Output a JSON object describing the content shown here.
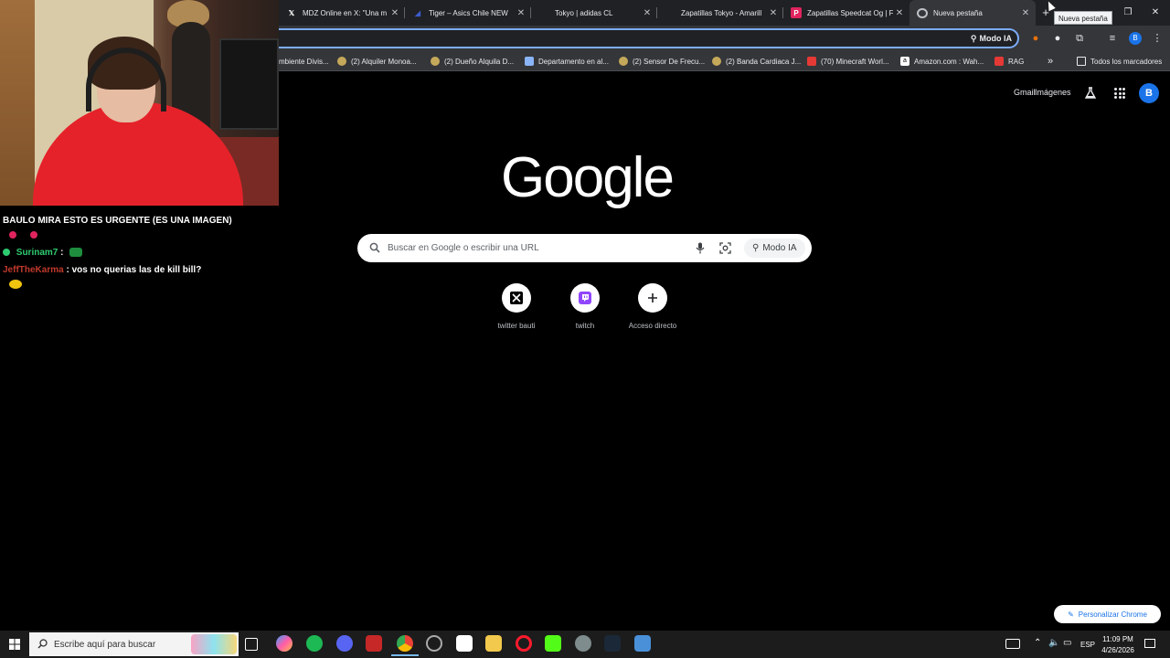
{
  "browser": {
    "tabs": [
      {
        "title": "MDZ Online en X: \"Una m",
        "icon": "x-logo-icon",
        "active": false
      },
      {
        "title": "Tiger – Asics Chile NEW",
        "icon": "asics-logo-icon",
        "active": false
      },
      {
        "title": "Tokyo | adidas CL",
        "icon": "adidas-logo-icon",
        "active": false
      },
      {
        "title": "Zapatillas Tokyo - Amarill",
        "icon": "adidas-logo-icon",
        "active": false
      },
      {
        "title": "Zapatillas Speedcat Og | F",
        "icon": "puma-logo-icon",
        "active": false
      },
      {
        "title": "Nueva pestaña",
        "icon": "chrome-icon",
        "active": true
      }
    ],
    "new_tab_tooltip": "Nueva pestaña",
    "omnibox": {
      "value": "",
      "modo_ia_label": "Modo IA"
    },
    "profile_initial": "B",
    "bookmarks": [
      {
        "label": "mbiente Divis..."
      },
      {
        "label": "(2) Alquiler Monoa..."
      },
      {
        "label": "(2) Dueño Alquila D..."
      },
      {
        "label": "Departamento en al..."
      },
      {
        "label": "(2) Sensor De Frecu..."
      },
      {
        "label": "(2) Banda Cardiaca J..."
      },
      {
        "label": "(70) Minecraft Worl..."
      },
      {
        "label": "Amazon.com : Wah..."
      },
      {
        "label": "RAG"
      }
    ],
    "bookmarks_overflow": "»",
    "all_bookmarks_label": "Todos los marcadores"
  },
  "ntp": {
    "gmail_label": "Gmail",
    "images_label": "Imágenes",
    "account_initial": "B",
    "logo_text": "Google",
    "search": {
      "placeholder": "Buscar en Google o escribir una URL",
      "modo_ia_label": "Modo IA"
    },
    "shortcuts": [
      {
        "label": "twitter bauti",
        "icon": "x-logo-icon"
      },
      {
        "label": "twitch",
        "icon": "twitch-icon"
      },
      {
        "label": "Acceso directo",
        "icon": "plus-icon"
      }
    ],
    "personalize_label": "Personalizar Chrome"
  },
  "chat": {
    "messages": [
      {
        "user": "",
        "text": "BAULO MIRA ESTO ES URGENTE (ES UNA IMAGEN)",
        "user_color": "#ffffff"
      },
      {
        "user": "Surinam7",
        "text": ":",
        "user_color": "#2ecc71"
      },
      {
        "user": "JeffTheKarma",
        "text": ": vos no querias las de kill bill?",
        "user_color": "#c0392b"
      }
    ]
  },
  "taskbar": {
    "search_placeholder": "Escribe aquí para buscar",
    "language": "ESP",
    "time": "11:09 PM",
    "date": "4/26/2026"
  }
}
